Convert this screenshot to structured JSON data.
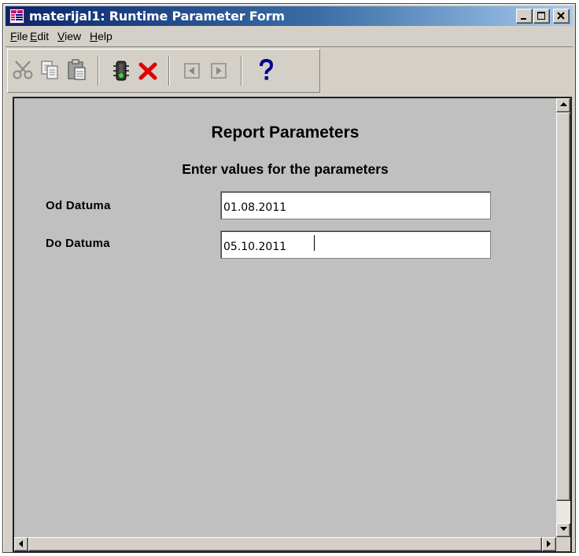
{
  "window": {
    "title": "materijal1: Runtime Parameter Form",
    "icon": "report-form-icon",
    "controls": [
      "minimize-icon",
      "maximize-icon",
      "close-icon"
    ]
  },
  "menu": {
    "file": {
      "accel": "F",
      "rest": "ile"
    },
    "edit": {
      "accel": "E",
      "rest": "dit"
    },
    "view": {
      "accel": "V",
      "rest": "iew"
    },
    "help": {
      "accel": "H",
      "rest": "elp"
    }
  },
  "toolbar": {
    "buttons": [
      "cut-icon",
      "copy-icon",
      "paste-icon",
      "run-traffic-light-icon",
      "cancel-x-icon",
      "previous-page-icon",
      "next-page-icon",
      "help-question-icon"
    ]
  },
  "form": {
    "heading": "Report Parameters",
    "subheading": "Enter values for the parameters",
    "params": [
      {
        "label": "Od Datuma",
        "value": "01.08.2011"
      },
      {
        "label": "Do Datuma",
        "value": "05.10.2011"
      }
    ]
  },
  "colors": {
    "titlebar_start": "#0a246a",
    "titlebar_end": "#a6caf0",
    "chrome": "#d4d0c8",
    "form_bg": "#c0c0c0",
    "cancel_red": "#e00000",
    "help_blue": "#0000a0"
  }
}
